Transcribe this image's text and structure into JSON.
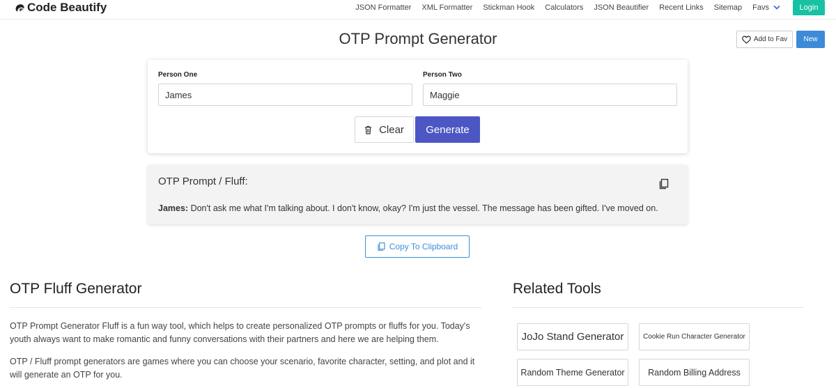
{
  "navbar": {
    "brand": "Code Beautify",
    "links": [
      {
        "label": "JSON Formatter",
        "name": "nav-json-formatter"
      },
      {
        "label": "XML Formatter",
        "name": "nav-xml-formatter"
      },
      {
        "label": "Stickman Hook",
        "name": "nav-stickman-hook"
      },
      {
        "label": "Calculators",
        "name": "nav-calculators"
      },
      {
        "label": "JSON Beautifier",
        "name": "nav-json-beautifier"
      },
      {
        "label": "Recent Links",
        "name": "nav-recent-links"
      },
      {
        "label": "Sitemap",
        "name": "nav-sitemap"
      }
    ],
    "favs_label": "Favs",
    "login_label": "Login"
  },
  "page": {
    "title": "OTP Prompt Generator",
    "add_fav_label": "Add to Fav",
    "new_label": "New"
  },
  "form": {
    "person_one_label": "Person One",
    "person_one_value": "James",
    "person_two_label": "Person Two",
    "person_two_value": "Maggie",
    "clear_label": "Clear",
    "generate_label": "Generate"
  },
  "result": {
    "heading": "OTP Prompt / Fluff:",
    "speaker": "James:",
    "text": "Don't ask me what I'm talking about. I don't know, okay? I'm just the vessel. The message has been gifted. I've moved on.",
    "copy_label": "Copy To Clipboard"
  },
  "about": {
    "title": "OTP Fluff Generator",
    "paragraphs": [
      "OTP Prompt Generator Fluff is a fun way tool, which helps to create personalized OTP prompts or fluffs for you. Today's youth always want to make romantic and funny conversations with their partners and here we are helping them.",
      "OTP / Fluff prompt generators are games where you can choose your scenario, favorite character, setting, and plot and it will generate an OTP for you."
    ]
  },
  "related": {
    "title": "Related Tools",
    "tools": [
      "JoJo Stand Generator",
      "Cookie Run Character Generator",
      "Random Theme Generator",
      "Random Billing Address"
    ]
  },
  "colors": {
    "login": "#17c1a3",
    "new_button": "#3d8bd8",
    "generate_button": "#4c57c4",
    "clipboard_accent": "#3a8ed8"
  },
  "icons": {
    "brand": "code-beautify-logo-icon",
    "favs": "chevron-down-icon",
    "fav": "heart-icon",
    "clear": "trash-icon",
    "copy": "copy-icon"
  }
}
